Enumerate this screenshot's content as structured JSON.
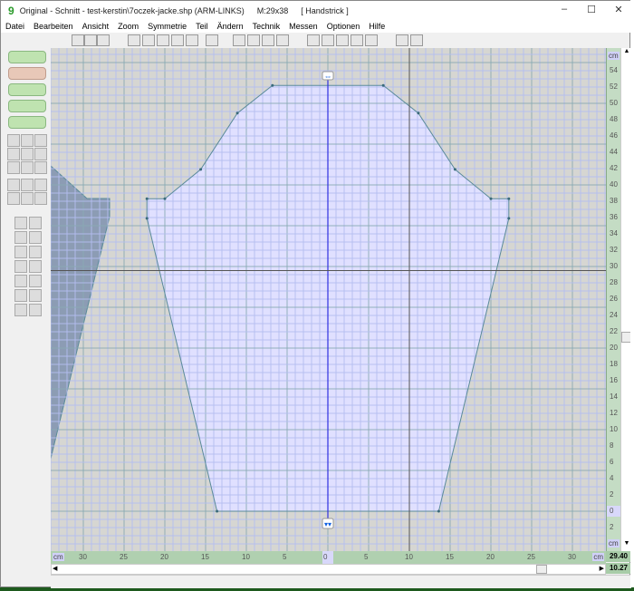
{
  "window": {
    "title": "Original - Schnitt - test-kerstin\\7oczek-jacke.shp (ARM-LINKS)",
    "measure": "M:29x38",
    "mode": "[ Handstrick ]",
    "logo": "9",
    "controls": [
      "–",
      "☐",
      "✕"
    ]
  },
  "menu": [
    "Datei",
    "Bearbeiten",
    "Ansicht",
    "Zoom",
    "Symmetrie",
    "Teil",
    "Ändern",
    "Technik",
    "Messen",
    "Optionen",
    "Hilfe"
  ],
  "toolbar_icons": [
    "cursor-icon",
    "select-frame-icon",
    "piece-outline-icon",
    "dot-grid-icon",
    "grid-icon",
    "image-icon",
    "edit-image-icon",
    "ruler-icon",
    "vertical-ruler-icon",
    "stairs-icon",
    "resize-icon",
    "arrows-icon",
    "sweater-icon",
    "zoom-icon",
    "zoom-small-icon",
    "zoom-in-icon",
    "zoom-out-icon",
    "zoom-fit-icon",
    "front-back-icon",
    "folder-icon"
  ],
  "left_buttons": [
    "sweater-piece-button",
    "graph-button",
    "sleeves-button",
    "slider-button",
    "picture-button"
  ],
  "left_icons": [
    "open-icon",
    "save-icon",
    "print-icon",
    "help-icon",
    "undo-icon",
    "redo-icon",
    "cut-icon",
    "copy-icon",
    "paste-icon",
    "curve-icon",
    "curve2-icon",
    "point-icon",
    "measure-icon",
    "tape-icon",
    "level-icon",
    "height-icon",
    "width-icon",
    "height2-icon",
    "width2-icon",
    "down-icon",
    "down2-icon",
    "mirror-icon",
    "move-icon",
    "rotate-cw-icon",
    "rotate-ccw-icon",
    "plus-icon",
    "minus-icon",
    "prev-icon",
    "next-icon"
  ],
  "ruler": {
    "unit": "cm",
    "x_labels": [
      "30",
      "25",
      "20",
      "15",
      "10",
      "5",
      "0",
      "5",
      "10",
      "15",
      "20",
      "25",
      "30"
    ],
    "y_labels": [
      "54",
      "52",
      "50",
      "48",
      "46",
      "44",
      "42",
      "40",
      "38",
      "36",
      "34",
      "32",
      "30",
      "28",
      "26",
      "24",
      "22",
      "20",
      "18",
      "16",
      "14",
      "12",
      "10",
      "8",
      "6",
      "4",
      "2",
      "0",
      "2"
    ]
  },
  "coords": {
    "x": "29.40",
    "y": "10.27"
  },
  "piece_outline_cm": [
    [
      -22.2,
      38.3
    ],
    [
      -20,
      38.3
    ],
    [
      -15.6,
      41.9
    ],
    [
      -11.1,
      48.8
    ],
    [
      -6.8,
      52.2
    ],
    [
      6.8,
      52.2
    ],
    [
      11.1,
      48.8
    ],
    [
      15.6,
      41.9
    ],
    [
      20,
      38.3
    ],
    [
      22.2,
      38.3
    ],
    [
      22.2,
      35.9
    ],
    [
      13.6,
      0
    ],
    [
      -13.6,
      0
    ],
    [
      -22.2,
      35.9
    ]
  ],
  "cursor_cm": [
    10,
    29.5
  ],
  "colors": {
    "piece_fill": "#e0e0ff",
    "piece_stroke": "#5a8a9a",
    "grid_minor": "#b4bef0",
    "grid_major": "#8aaab4",
    "canvas": "#d6d6d2",
    "axis": "#3030e0",
    "ruler": "#b0d0b0"
  }
}
